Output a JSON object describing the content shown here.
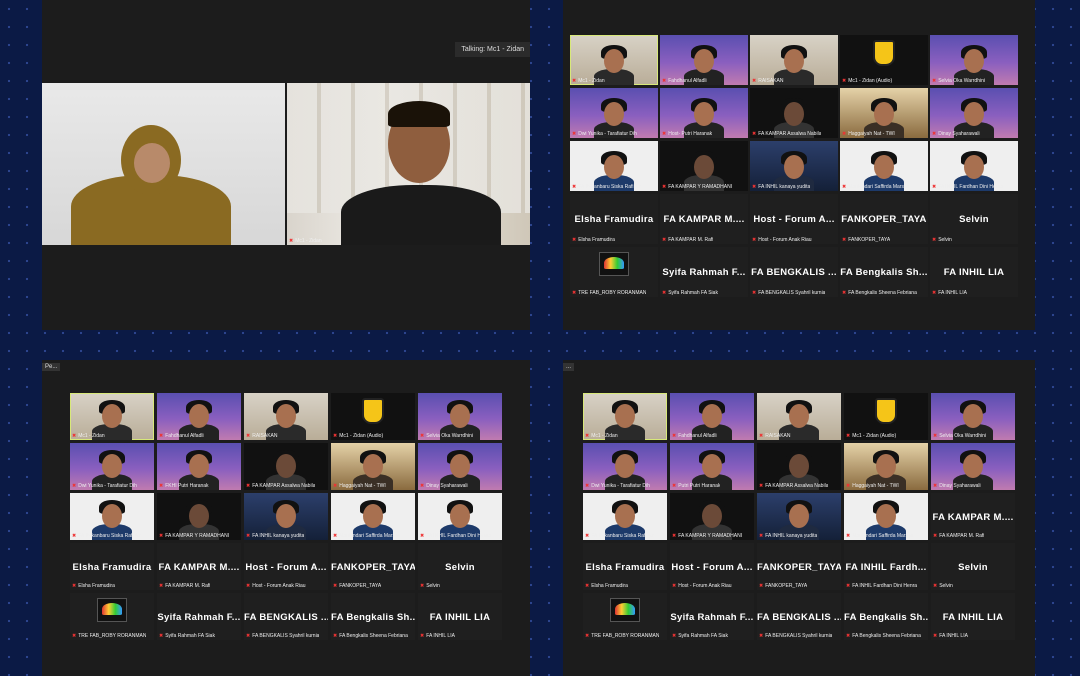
{
  "talking_label": "Talking: Mc1 - Zidan",
  "speaker": {
    "left_tile": {
      "label": ""
    },
    "right_tile": {
      "label": "Mc1 - Zidan"
    }
  },
  "window_titles": {
    "q3": "Pe...",
    "q4": "..."
  },
  "grid_q2": [
    [
      "Mc1 - Zidan",
      "Fahdhanul Alfadli",
      "RAISAKAN",
      "Mc1 - Zidan (Audio)",
      "Selvia Oka Warrdhini"
    ],
    [
      "Dwi Yunika - Tarafiatur Dih",
      "Host- Putri Haranak",
      "FA KAMPAR Assalwa Nabila",
      "Haggaiyah Nat - TWI",
      "Dinay Syaharawali"
    ],
    [
      "FA Pekanbaru Siska Rafi Az...",
      "FA KAMPAR Y RAMADHANI",
      "FA INHIL kanaya yudita",
      "Maulandari Saffirda Marsau",
      "FA INHIL Fardhan Dini Henra"
    ],
    [
      "Elsha Framudira",
      "FA KAMPAR M. Rafi",
      "Host - Forum Anak Riau",
      "FANKOPER_TAYA",
      "Selvin"
    ],
    [
      "TRE FAB_ROBY RORANMAN",
      "Syifa Rahmah FA Siak",
      "FA BENGKALIS Syahril kurnia",
      "FA Bengkalis Sheena Febriana",
      "FA INHIL LIA"
    ]
  ],
  "grid_q2_big": [
    [
      "",
      "",
      "",
      "",
      ""
    ],
    [
      "",
      "",
      "",
      "",
      ""
    ],
    [
      "",
      "",
      "",
      "",
      ""
    ],
    [
      "Elsha Framudira",
      "FA KAMPAR M....",
      "Host - Forum A...",
      "FANKOPER_TAYA",
      "Selvin"
    ],
    [
      "",
      "Syifa Rahmah F...",
      "FA BENGKALIS ...",
      "FA Bengkalis Sh...",
      "FA INHIL LIA"
    ]
  ],
  "grid_q3": [
    [
      "Mc1 - Zidan",
      "Fahdhanul Alfadli",
      "RAISAKAN",
      "Mc1 - Zidan (Audio)",
      "Selvia Oka Warrdhini"
    ],
    [
      "Dwi Yunika - Tarafiatur Dih",
      "FKHI Putri Haranak",
      "FA KAMPAR Assalwa Nabila",
      "Haggaiyah Nat - TWI",
      "Dinay Syaharawali"
    ],
    [
      "FA Pekanbaru Siska Rafi Az...",
      "FA KAMPAR Y RAMADHANI",
      "FA INHIL kanaya yudita",
      "Maulandari Saffirda Marsau",
      "FA INHIL Fardhan Dini Henra"
    ],
    [
      "Elsha Framudira",
      "FA KAMPAR M. Rafi",
      "Host - Forum Anak Riau",
      "FANKOPER_TAYA",
      "Selvin"
    ],
    [
      "TRE FAB_ROBY RORANMAN",
      "Syifa Rahmah FA Siak",
      "FA BENGKALIS Syahril kurnia",
      "FA Bengkalis Sheena Febriana",
      "FA INHIL LIA"
    ]
  ],
  "grid_q3_big": [
    [
      "",
      "",
      "",
      "",
      ""
    ],
    [
      "",
      "",
      "",
      "",
      ""
    ],
    [
      "",
      "",
      "",
      "",
      ""
    ],
    [
      "Elsha Framudira",
      "FA KAMPAR M....",
      "Host - Forum A...",
      "FANKOPER_TAYA",
      "Selvin"
    ],
    [
      "",
      "Syifa Rahmah F...",
      "FA BENGKALIS ...",
      "FA Bengkalis Sh...",
      "FA INHIL LIA"
    ]
  ],
  "grid_q4": [
    [
      "Mc1 - Zidan",
      "Fahdhanul Alfadli",
      "RAISAKAN",
      "Mc1 - Zidan (Audio)",
      "Selvia Oka Warrdhini"
    ],
    [
      "Dwi Yunika - Tarafiatur Dih",
      "Putri Putri Haranak",
      "FA KAMPAR Assalwa Nabila",
      "Haggaiyah Nat - TWI",
      "Dinay Syaharawali"
    ],
    [
      "FA Pekanbaru Siska Rafi Az...",
      "FA KAMPAR Y RAMADHANI",
      "FA INHIL kanaya yudita",
      "Maulandari Saffirda Marsau",
      "FA KAMPAR M. Rafi"
    ],
    [
      "Elsha Framudira",
      "Host - Forum Anak Riau",
      "FANKOPER_TAYA",
      "FA INHIL Fardhan Dini Henra",
      "Selvin"
    ],
    [
      "TRE FAB_ROBY RORANMAN",
      "Syifa Rahmah FA Siak",
      "FA BENGKALIS Syahril kurnia",
      "FA Bengkalis Sheena Febriana",
      "FA INHIL LIA"
    ]
  ],
  "grid_q4_big": [
    [
      "",
      "",
      "",
      "",
      ""
    ],
    [
      "",
      "",
      "",
      "",
      ""
    ],
    [
      "",
      "",
      "",
      "",
      "FA KAMPAR M...."
    ],
    [
      "Elsha Framudira",
      "Host - Forum A...",
      "FANKOPER_TAYA",
      "FA INHIL Fardh...",
      "Selvin"
    ],
    [
      "",
      "Syifa Rahmah F...",
      "FA BENGKALIS ...",
      "FA Bengkalis Sh...",
      "FA INHIL LIA"
    ]
  ],
  "tile_styles": {
    "q2": [
      [
        "room",
        "purple",
        "room",
        "shield",
        "purple"
      ],
      [
        "purple",
        "purple",
        "dark",
        "warm",
        "purple"
      ],
      [
        "white",
        "dark",
        "blue",
        "white",
        "white"
      ],
      [
        "name",
        "name",
        "name",
        "name",
        "name"
      ],
      [
        "logo",
        "name",
        "name",
        "name",
        "name"
      ]
    ],
    "q3": [
      [
        "room",
        "purple",
        "room",
        "shield",
        "purple"
      ],
      [
        "purple",
        "purple",
        "dark",
        "warm",
        "purple"
      ],
      [
        "white",
        "dark",
        "blue",
        "white",
        "white"
      ],
      [
        "name",
        "name",
        "name",
        "name",
        "name"
      ],
      [
        "logo",
        "name",
        "name",
        "name",
        "name"
      ]
    ],
    "q4": [
      [
        "room",
        "purple",
        "room",
        "shield",
        "purple"
      ],
      [
        "purple",
        "purple",
        "dark",
        "warm",
        "purple"
      ],
      [
        "white",
        "dark",
        "blue",
        "white",
        "name"
      ],
      [
        "name",
        "name",
        "name",
        "name",
        "name"
      ],
      [
        "logo",
        "name",
        "name",
        "name",
        "name"
      ]
    ]
  },
  "colors": {
    "background": "#0b1a45",
    "window": "#1c1c1c",
    "active_border": "#d8e87a",
    "mic_muted": "#e33333"
  },
  "icons": {
    "mic": "muted-mic-icon"
  }
}
